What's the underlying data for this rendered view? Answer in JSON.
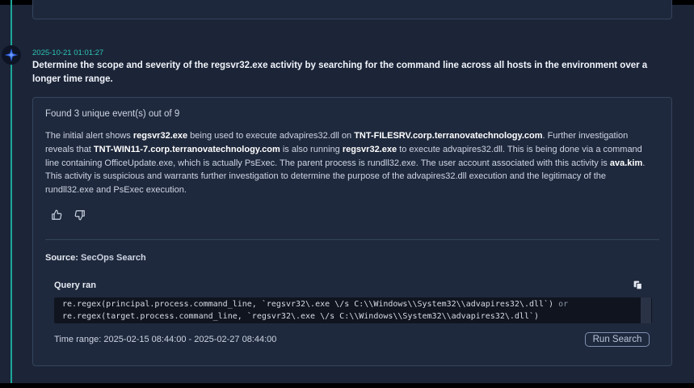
{
  "entry": {
    "timestamp": "2025-10-21 01:01:27",
    "question": {
      "pre": "Determine the scope and severity of the ",
      "bold": "regsvr32.exe",
      "post": " activity by searching for the command line across all hosts in the environment over a longer time range."
    }
  },
  "result": {
    "count_text": "Found 3 unique event(s) out of 9",
    "summary": [
      {
        "t": "The initial alert shows ",
        "b": false
      },
      {
        "t": "regsvr32.exe",
        "b": true
      },
      {
        "t": " being used to execute advapires32.dll on ",
        "b": false
      },
      {
        "t": "TNT-FILESRV.corp.terranovatechnology.com",
        "b": true
      },
      {
        "t": ". Further investigation reveals that ",
        "b": false
      },
      {
        "t": "TNT-WIN11-7.corp.terranovatechnology.com",
        "b": true
      },
      {
        "t": " is also running ",
        "b": false
      },
      {
        "t": "regsvr32.exe",
        "b": true
      },
      {
        "t": " to execute advapires32.dll. This is being done via a command line containing OfficeUpdate.exe, which is actually PsExec. The parent process is rundll32.exe. The user account associated with this activity is ",
        "b": false
      },
      {
        "t": "ava.kim",
        "b": true
      },
      {
        "t": ". This activity is suspicious and warrants further investigation to determine the purpose of the advapires32.dll execution and the legitimacy of the rundll32.exe and PsExec execution.",
        "b": false
      }
    ],
    "source_label": "Source:",
    "source_value": "SecOps Search",
    "query_label": "Query ran",
    "query_line1": "re.regex(principal.process.command_line, `regsvr32\\.exe \\/s C:\\\\Windows\\\\System32\\\\advapires32\\.dll`)",
    "query_or": "or",
    "query_line2": "re.regex(target.process.command_line, `regsvr32\\.exe \\/s C:\\\\Windows\\\\System32\\\\advapires32\\.dll`)",
    "time_range": "Time range: 2025-02-15 08:44:00 - 2025-02-27 08:44:00",
    "run_search_label": "Run Search"
  },
  "icons": {
    "timeline_marker": "sparkle-icon",
    "thumbs_up": "thumbs-up-icon",
    "thumbs_down": "thumbs-down-icon",
    "copy": "copy-icon"
  },
  "colors": {
    "accent": "#2ec4b4",
    "background": "#1c2538",
    "card": "#1f293d",
    "code_bg": "#0f141f"
  }
}
